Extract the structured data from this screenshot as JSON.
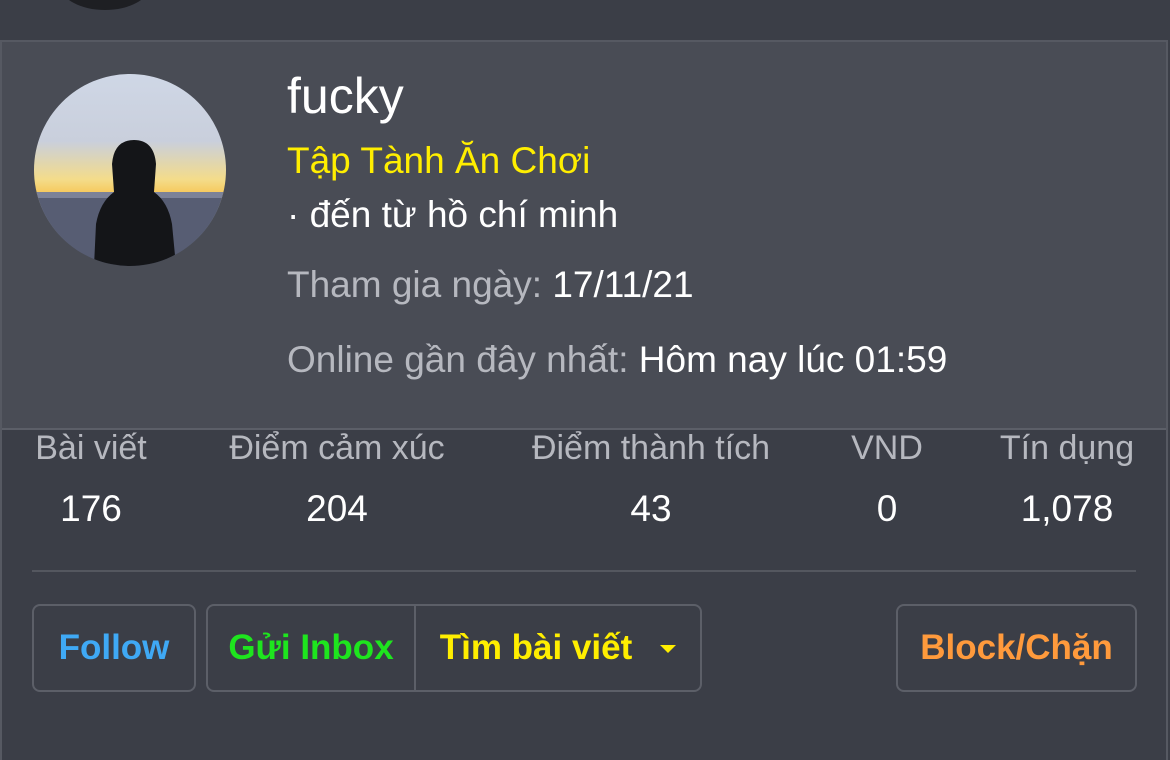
{
  "profile": {
    "username": "fucky",
    "title": "Tập Tành Ăn Chơi",
    "location": "· đến từ hồ chí minh",
    "joined_label": "Tham gia ngày:",
    "joined_value": "17/11/21",
    "online_label": "Online gần đây nhất:",
    "online_value": "Hôm nay lúc 01:59",
    "avatar_icon": "hooded-figure-sunset-avatar"
  },
  "stats": [
    {
      "label": "Bài viết",
      "value": "176"
    },
    {
      "label": "Điểm cảm xúc",
      "value": "204"
    },
    {
      "label": "Điểm thành tích",
      "value": "43"
    },
    {
      "label": "VND",
      "value": "0"
    },
    {
      "label": "Tín dụng",
      "value": "1,078"
    }
  ],
  "actions": {
    "follow": "Follow",
    "inbox": "Gửi Inbox",
    "find_posts": "Tìm bài viết",
    "find_posts_icon": "caret-down-icon",
    "block": "Block/Chặn"
  },
  "colors": {
    "title": "#ffee00",
    "follow": "#3fa9f5",
    "inbox": "#1ee51e",
    "find_posts": "#ffee00",
    "block": "#ff9a3c",
    "card_top_bg": "#494c55",
    "card_bottom_bg": "#3b3e47"
  }
}
